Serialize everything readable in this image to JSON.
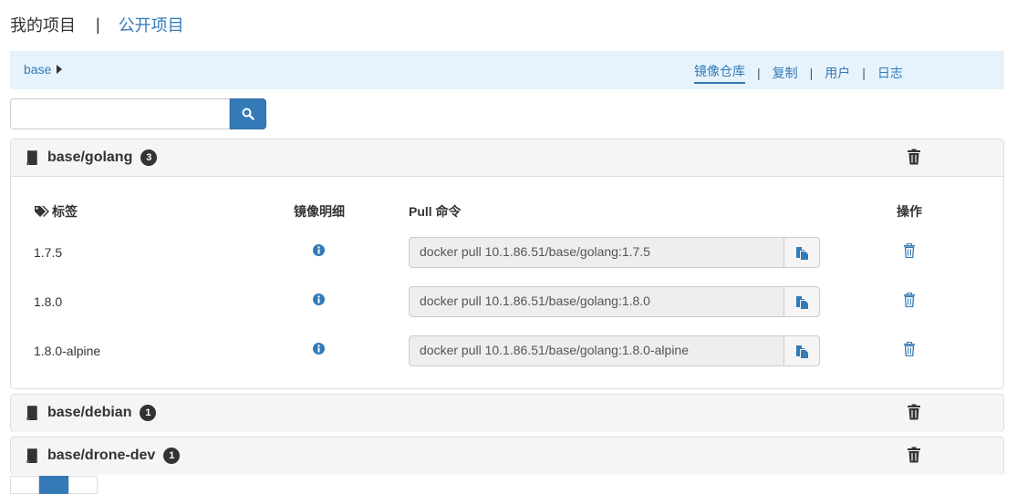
{
  "top_tabs": {
    "mine": "我的项目",
    "separator": "|",
    "public": "公开项目"
  },
  "nav": {
    "project": "base",
    "links": [
      "镜像仓库",
      "复制",
      "用户",
      "日志"
    ],
    "separator": "|"
  },
  "search": {
    "placeholder": "",
    "value": ""
  },
  "repos": [
    {
      "name": "base/golang",
      "count": "3",
      "headers": {
        "tag": "标签",
        "detail": "镜像明细",
        "pull": "Pull 命令",
        "ops": "操作"
      },
      "tags": [
        {
          "tag": "1.7.5",
          "pull": "docker pull 10.1.86.51/base/golang:1.7.5"
        },
        {
          "tag": "1.8.0",
          "pull": "docker pull 10.1.86.51/base/golang:1.8.0"
        },
        {
          "tag": "1.8.0-alpine",
          "pull": "docker pull 10.1.86.51/base/golang:1.8.0-alpine"
        }
      ]
    },
    {
      "name": "base/debian",
      "count": "1"
    },
    {
      "name": "base/drone-dev",
      "count": "1"
    }
  ],
  "colors": {
    "accent": "#337ab7",
    "nav_bg": "#e6f3fc",
    "panel_head": "#f5f5f5"
  },
  "icons": [
    "search-icon",
    "book-icon",
    "trash-icon",
    "tags-icon",
    "info-icon",
    "copy-icon"
  ]
}
